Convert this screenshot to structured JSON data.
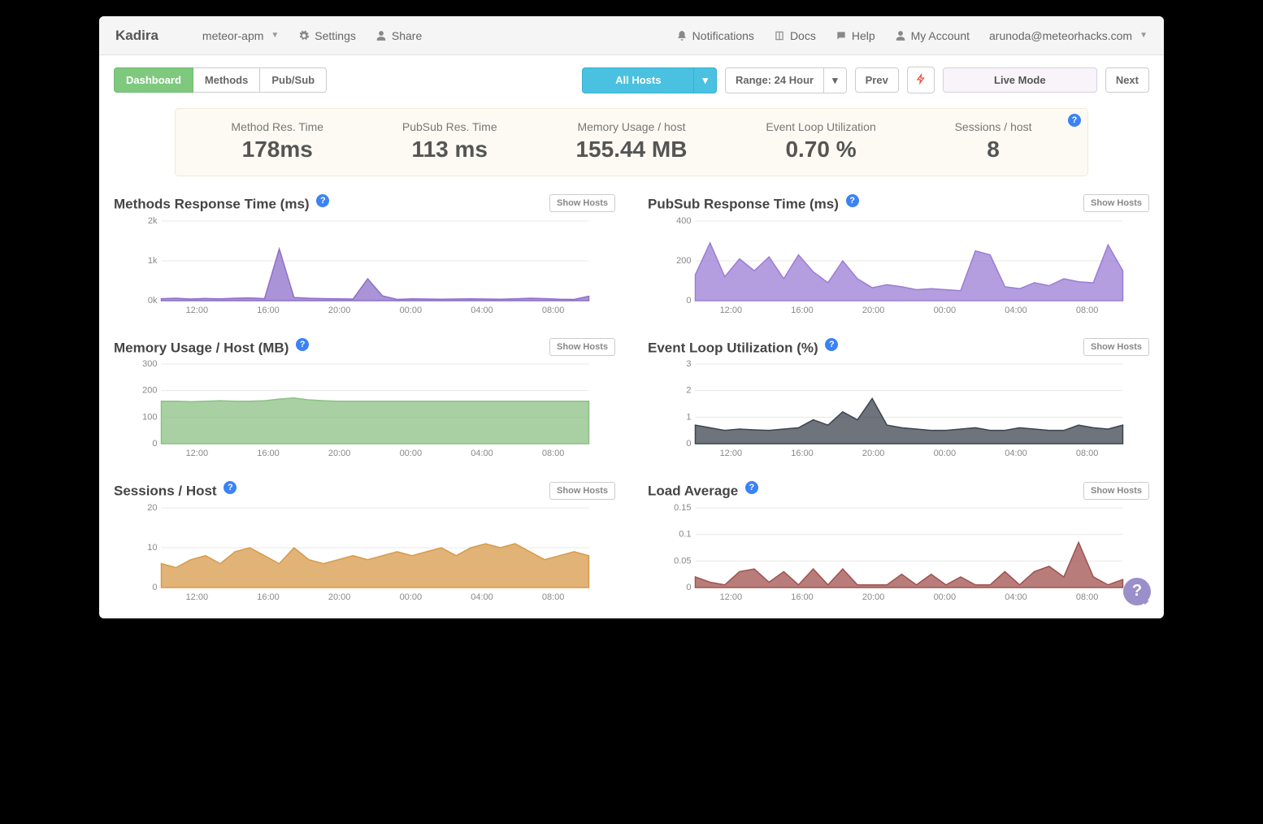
{
  "brand": "Kadira",
  "topbar": {
    "app": "meteor-apm",
    "settings": "Settings",
    "share": "Share",
    "notifications": "Notifications",
    "docs": "Docs",
    "help": "Help",
    "account": "My Account",
    "user": "arunoda@meteorhacks.com"
  },
  "tabs": {
    "dashboard": "Dashboard",
    "methods": "Methods",
    "pubsub": "Pub/Sub"
  },
  "controls": {
    "allhosts": "All Hosts",
    "range": "Range: 24 Hour",
    "prev": "Prev",
    "live": "Live Mode",
    "next": "Next"
  },
  "summary": [
    {
      "label": "Method Res. Time",
      "value": "178ms"
    },
    {
      "label": "PubSub Res. Time",
      "value": "113 ms"
    },
    {
      "label": "Memory Usage / host",
      "value": "155.44 MB"
    },
    {
      "label": "Event Loop Utilization",
      "value": "0.70 %"
    },
    {
      "label": "Sessions / host",
      "value": "8"
    }
  ],
  "showHosts": "Show Hosts",
  "xTicks": [
    "12:00",
    "16:00",
    "20:00",
    "00:00",
    "04:00",
    "08:00"
  ],
  "charts": {
    "methods": {
      "title": "Methods Response Time (ms)",
      "color": "#8e6fc9",
      "yTicks": [
        "0k",
        "1k",
        "2k"
      ],
      "ymax": 2000,
      "values": [
        50,
        60,
        40,
        55,
        45,
        60,
        70,
        50,
        1300,
        80,
        60,
        50,
        45,
        40,
        550,
        120,
        30,
        45,
        40,
        35,
        40,
        45,
        40,
        35,
        45,
        60,
        50,
        35,
        30,
        110
      ]
    },
    "pubsub": {
      "title": "PubSub Response Time (ms)",
      "color": "#9b7dd4",
      "yTicks": [
        "0",
        "200",
        "400"
      ],
      "ymax": 400,
      "values": [
        130,
        290,
        120,
        210,
        150,
        220,
        110,
        230,
        145,
        90,
        200,
        110,
        65,
        80,
        70,
        55,
        60,
        55,
        50,
        250,
        230,
        70,
        60,
        90,
        75,
        110,
        95,
        90,
        280,
        150
      ]
    },
    "memory": {
      "title": "Memory Usage / Host (MB)",
      "color": "#8cc084",
      "yTicks": [
        "0",
        "100",
        "200",
        "300"
      ],
      "ymax": 300,
      "values": [
        160,
        160,
        158,
        160,
        162,
        160,
        160,
        162,
        168,
        172,
        165,
        162,
        160,
        160,
        160,
        160,
        160,
        160,
        160,
        160,
        160,
        160,
        160,
        160,
        160,
        160,
        160,
        160,
        160,
        160
      ]
    },
    "eventloop": {
      "title": "Event Loop Utilization (%)",
      "color": "#3d4450",
      "yTicks": [
        "0",
        "1",
        "2",
        "3"
      ],
      "ymax": 3,
      "values": [
        0.7,
        0.6,
        0.5,
        0.55,
        0.52,
        0.5,
        0.55,
        0.6,
        0.9,
        0.7,
        1.2,
        0.9,
        1.7,
        0.7,
        0.6,
        0.55,
        0.5,
        0.5,
        0.55,
        0.6,
        0.5,
        0.5,
        0.6,
        0.55,
        0.5,
        0.5,
        0.7,
        0.6,
        0.55,
        0.7
      ]
    },
    "sessions": {
      "title": "Sessions / Host",
      "color": "#d79a4a",
      "yTicks": [
        "0",
        "10",
        "20"
      ],
      "ymax": 20,
      "values": [
        6,
        5,
        7,
        8,
        6,
        9,
        10,
        8,
        6,
        10,
        7,
        6,
        7,
        8,
        7,
        8,
        9,
        8,
        9,
        10,
        8,
        10,
        11,
        10,
        11,
        9,
        7,
        8,
        9,
        8
      ]
    },
    "load": {
      "title": "Load Average",
      "color": "#a0524f",
      "yTicks": [
        "0",
        "0.05",
        "0.1",
        "0.15"
      ],
      "ymax": 0.15,
      "values": [
        0.02,
        0.01,
        0.005,
        0.03,
        0.035,
        0.01,
        0.03,
        0.005,
        0.035,
        0.005,
        0.035,
        0.005,
        0.005,
        0.005,
        0.025,
        0.005,
        0.025,
        0.005,
        0.02,
        0.005,
        0.005,
        0.03,
        0.005,
        0.03,
        0.04,
        0.02,
        0.085,
        0.02,
        0.005,
        0.015
      ]
    }
  }
}
